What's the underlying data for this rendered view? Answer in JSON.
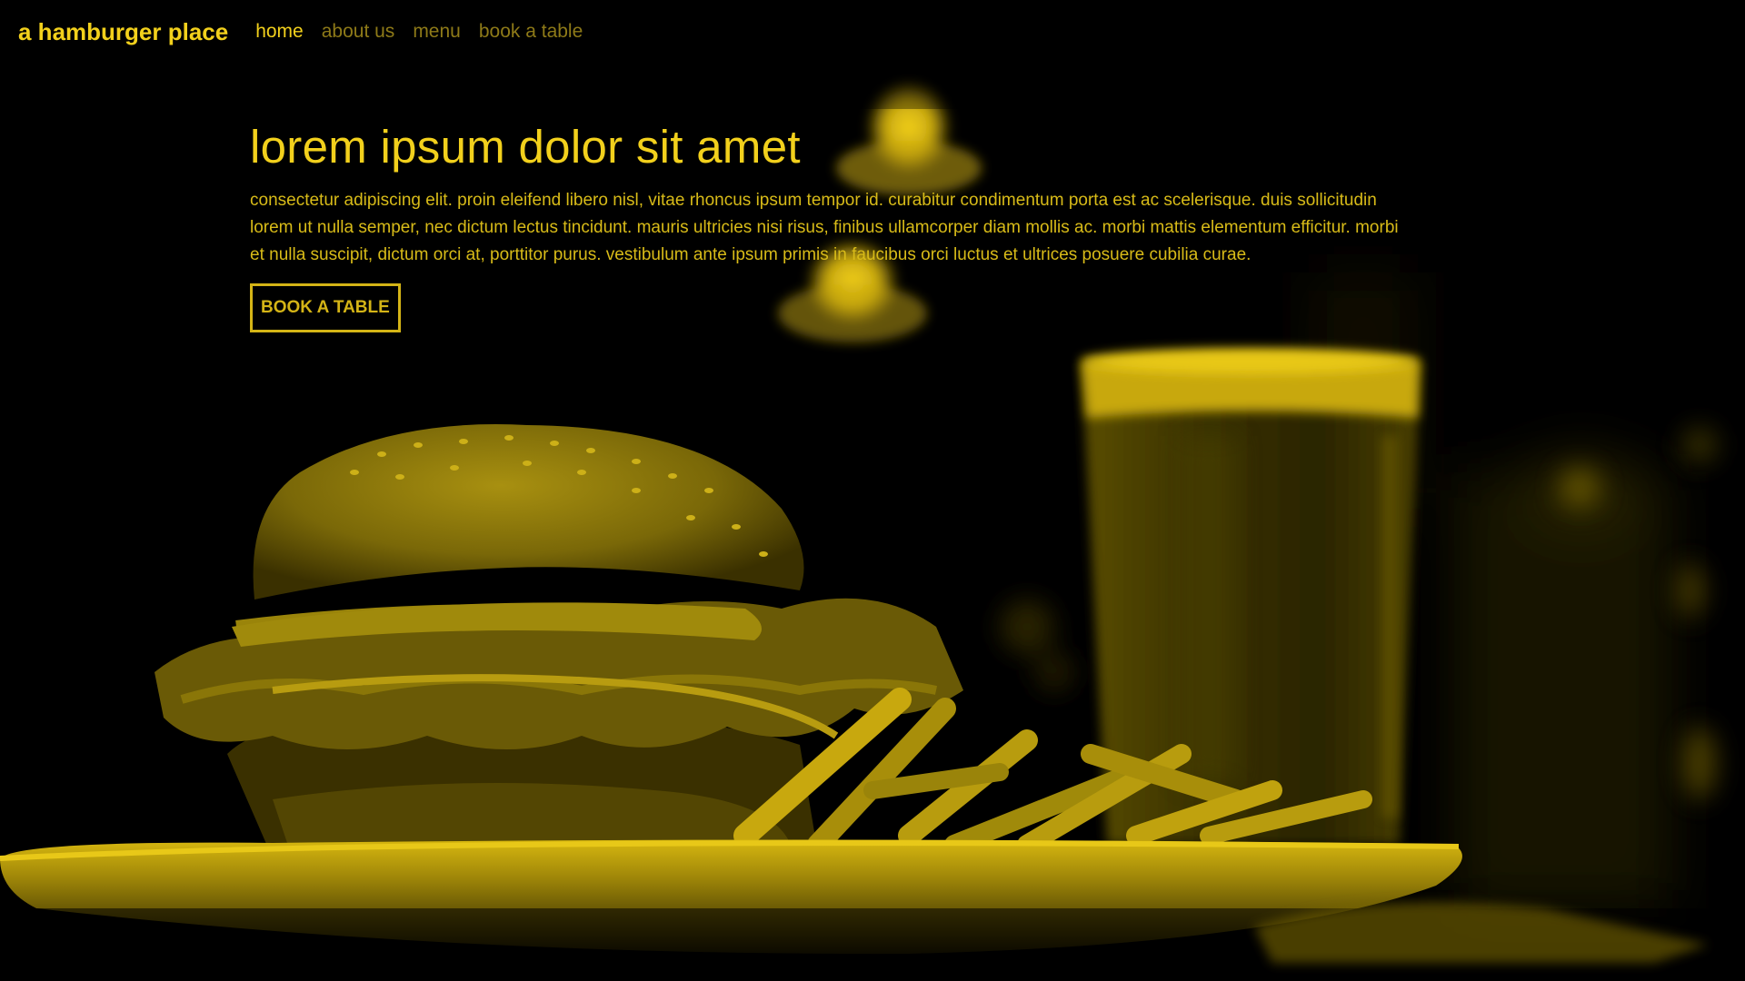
{
  "header": {
    "brand": "a hamburger place",
    "nav": [
      {
        "label": "home",
        "active": true
      },
      {
        "label": "about us",
        "active": false
      },
      {
        "label": "menu",
        "active": false
      },
      {
        "label": "book a table",
        "active": false
      }
    ]
  },
  "hero": {
    "headline": "lorem ipsum dolor sit amet",
    "body": "consectetur adipiscing elit. proin eleifend libero nisl, vitae rhoncus ipsum tempor id. curabitur condimentum porta est ac scelerisque. duis sollicitudin lorem ut nulla semper, nec dictum lectus tincidunt. mauris ultricies nisi risus, finibus ullamcorper diam mollis ac. morbi mattis elementum efficitur. morbi et nulla suscipit, dictum orci at, porttitor purus. vestibulum ante ipsum primis in faucibus orci luctus et ultrices posuere cubilia curae.",
    "cta_label": "BOOK A TABLE",
    "image_subject": "burger-with-fries-and-beer-photo"
  },
  "colors": {
    "background": "#000000",
    "accent": "#f2d01c",
    "nav_inactive": "#8e7a18",
    "body_text": "#d8bb18"
  }
}
